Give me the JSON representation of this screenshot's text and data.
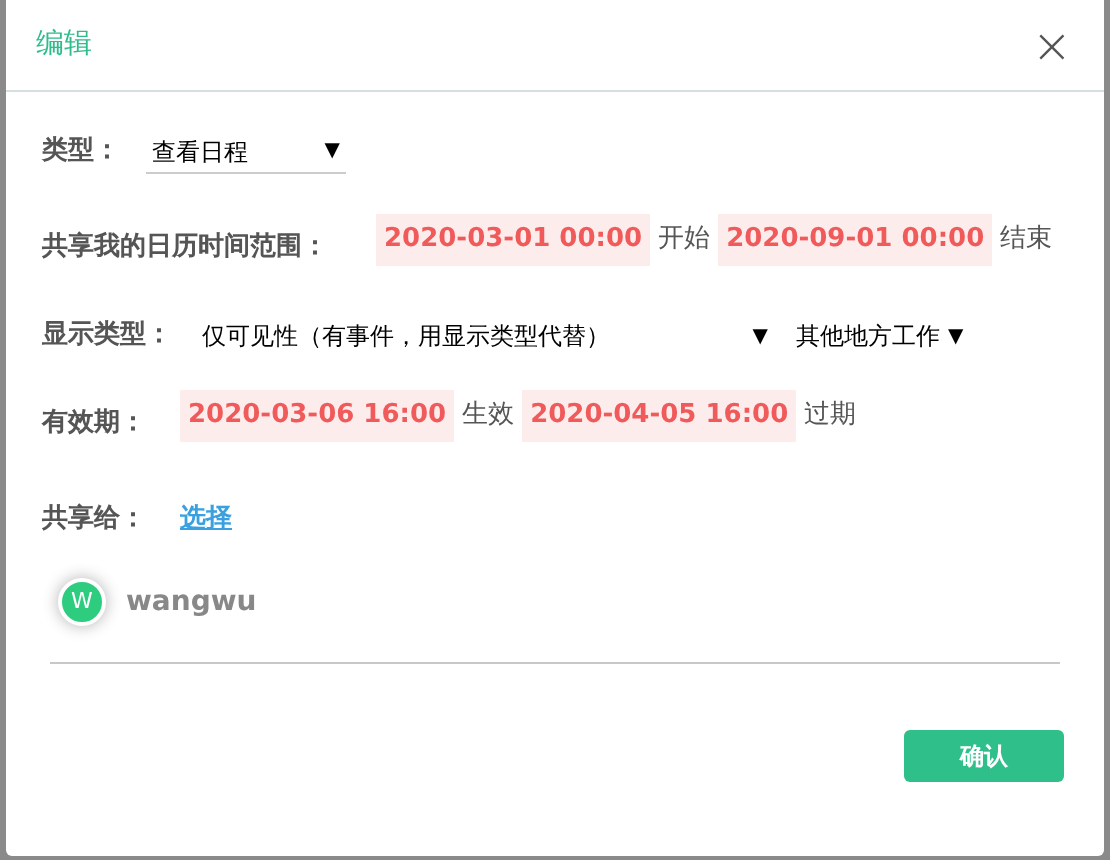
{
  "dialog": {
    "title": "编辑",
    "close": "×"
  },
  "type_row": {
    "label": "类型：",
    "value": "查看日程",
    "arrow": "▼"
  },
  "range_row": {
    "label": "共享我的日历时间范围：",
    "start": "2020-03-01 00:00",
    "start_text": "开始",
    "end": "2020-09-01 00:00",
    "end_text": "结束"
  },
  "display_row": {
    "label": "显示类型：",
    "value": "仅可见性（有事件，用显示类型代替）",
    "arrow": "▼",
    "value_2": "其他地方工作",
    "arrow_2": "▼"
  },
  "valid_row": {
    "label": "有效期：",
    "start": "2020-03-06 16:00",
    "start_text": "生效",
    "end": "2020-04-05 16:00",
    "end_text": "过期"
  },
  "share_row": {
    "label": "共享给：",
    "link": "选择"
  },
  "users": [
    {
      "initial": "W",
      "name": "wangwu"
    }
  ],
  "confirm_button": "确认"
}
